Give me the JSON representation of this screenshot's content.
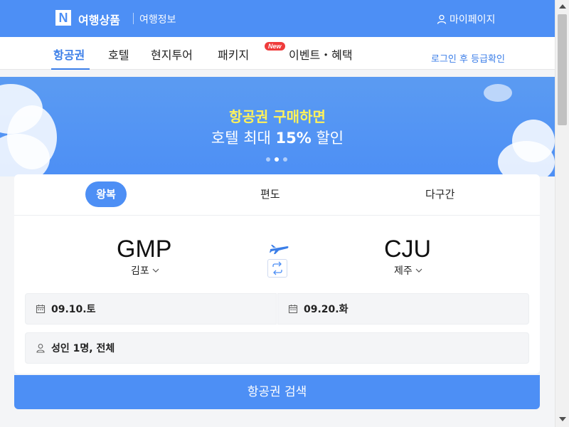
{
  "header": {
    "logo_letter": "N",
    "brand": "여행상품",
    "subnav": "여행정보",
    "mypage": "마이페이지",
    "background": "#4d8ff5"
  },
  "tabs": [
    {
      "label": "항공권",
      "active": true
    },
    {
      "label": "호텔"
    },
    {
      "label": "현지투어"
    },
    {
      "label": "패키지"
    },
    {
      "label": "이벤트・혜택",
      "badge": "New"
    }
  ],
  "grade_link": "로그인 후 등급확인",
  "banner": {
    "title": "항공권 구매하면",
    "sub_prefix": "호텔 최대 ",
    "sub_highlight": "15%",
    "sub_suffix": " 할인",
    "slides": 3,
    "active_slide": 2
  },
  "trip_tabs": [
    "왕복",
    "편도",
    "다구간"
  ],
  "route": {
    "from_code": "GMP",
    "from_city": "김포",
    "to_code": "CJU",
    "to_city": "제주"
  },
  "dates": {
    "depart": "09.10.토",
    "return": "09.20.화"
  },
  "passengers": "성인 1명, 전체",
  "search_button": "항공권 검색",
  "icons": [
    "user-icon",
    "chevron-down-icon",
    "airplane-icon",
    "swap-icon",
    "calendar-icon",
    "person-icon"
  ]
}
